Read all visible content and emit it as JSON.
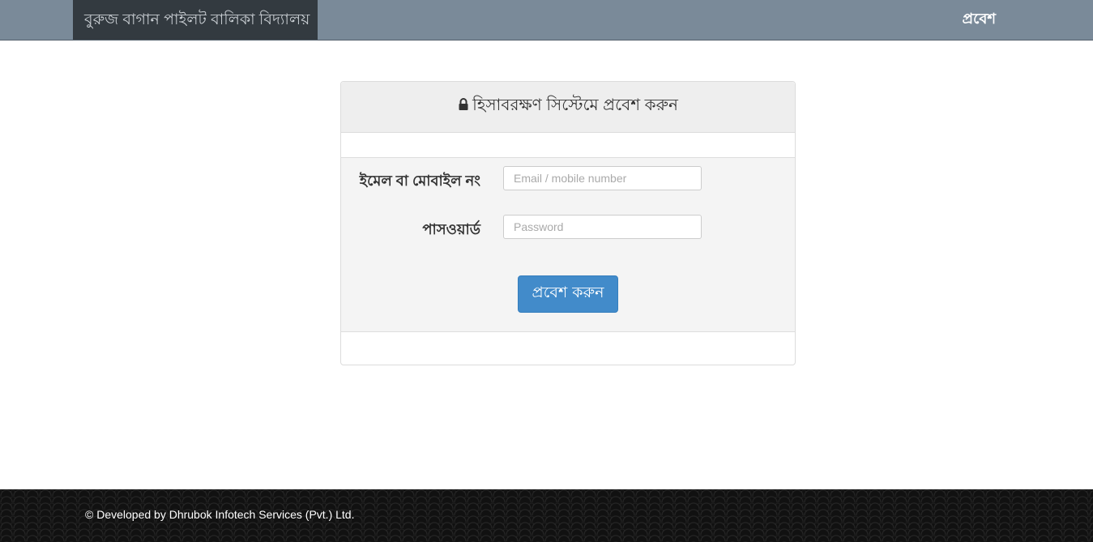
{
  "navbar": {
    "brand": "বুরুজ বাগান পাইলট বালিকা বিদ্যালয়",
    "login_link": "প্রবেশ"
  },
  "login_panel": {
    "title": "হিসাবরক্ষণ সিস্টেমে প্রবেশ করুন",
    "title_icon": "lock-icon",
    "email_label": "ইমেল বা মোবাইল নং",
    "email_placeholder": "Email / mobile number",
    "email_value": "",
    "password_label": "পাসওয়ার্ড",
    "password_placeholder": "Password",
    "password_value": "",
    "submit_label": "প্রবেশ করুন"
  },
  "footer": {
    "text": "© Developed by Dhrubok Infotech Services (Pvt.) Ltd."
  },
  "colors": {
    "navbar_bg": "#7a8a99",
    "brand_bg": "#333a40",
    "primary_button": "#428bca",
    "footer_bg": "#111111"
  }
}
